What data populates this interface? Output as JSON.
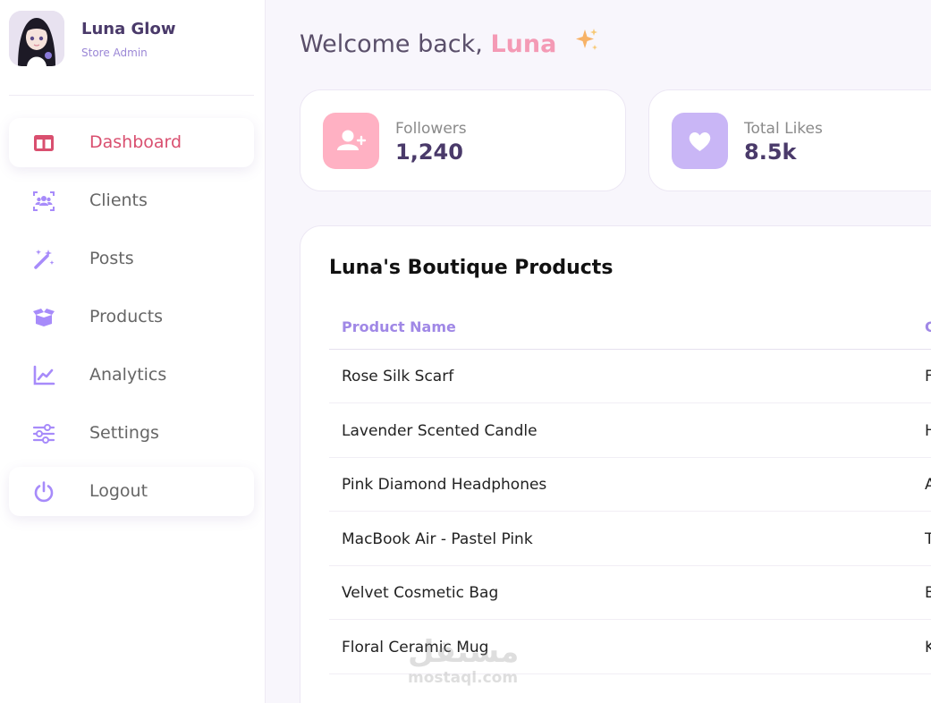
{
  "profile": {
    "name": "Luna Glow",
    "role": "Store Admin"
  },
  "nav": {
    "items": [
      {
        "label": "Dashboard",
        "icon": "columns-icon"
      },
      {
        "label": "Clients",
        "icon": "users-icon"
      },
      {
        "label": "Posts",
        "icon": "magic-wand-icon"
      },
      {
        "label": "Products",
        "icon": "box-icon"
      },
      {
        "label": "Analytics",
        "icon": "chart-line-icon"
      },
      {
        "label": "Settings",
        "icon": "sliders-icon"
      },
      {
        "label": "Logout",
        "icon": "power-icon"
      }
    ],
    "active": "Dashboard"
  },
  "welcome": {
    "prefix": "Welcome back,",
    "name": "Luna"
  },
  "stats": [
    {
      "label": "Followers",
      "value": "1,240",
      "icon": "add-user-icon",
      "color": "#ffb1c3"
    },
    {
      "label": "Total Likes",
      "value": "8.5k",
      "icon": "heart-icon",
      "color": "#c9b6f6"
    }
  ],
  "products": {
    "title": "Luna's Boutique Products",
    "columns": [
      "Product Name",
      "C"
    ],
    "rows": [
      {
        "name": "Rose Silk Scarf",
        "second": "F"
      },
      {
        "name": "Lavender Scented Candle",
        "second": "H"
      },
      {
        "name": "Pink Diamond Headphones",
        "second": "A"
      },
      {
        "name": "MacBook Air - Pastel Pink",
        "second": "T"
      },
      {
        "name": "Velvet Cosmetic Bag",
        "second": "B"
      },
      {
        "name": "Floral Ceramic Mug",
        "second": "K"
      }
    ]
  },
  "watermark": {
    "arabic": "مستقل",
    "latin": "mostaql.com"
  },
  "colors": {
    "accent_pink": "#d94f6f",
    "accent_purple": "#9b87d6",
    "sidebar_icon": "#a78bfa"
  }
}
